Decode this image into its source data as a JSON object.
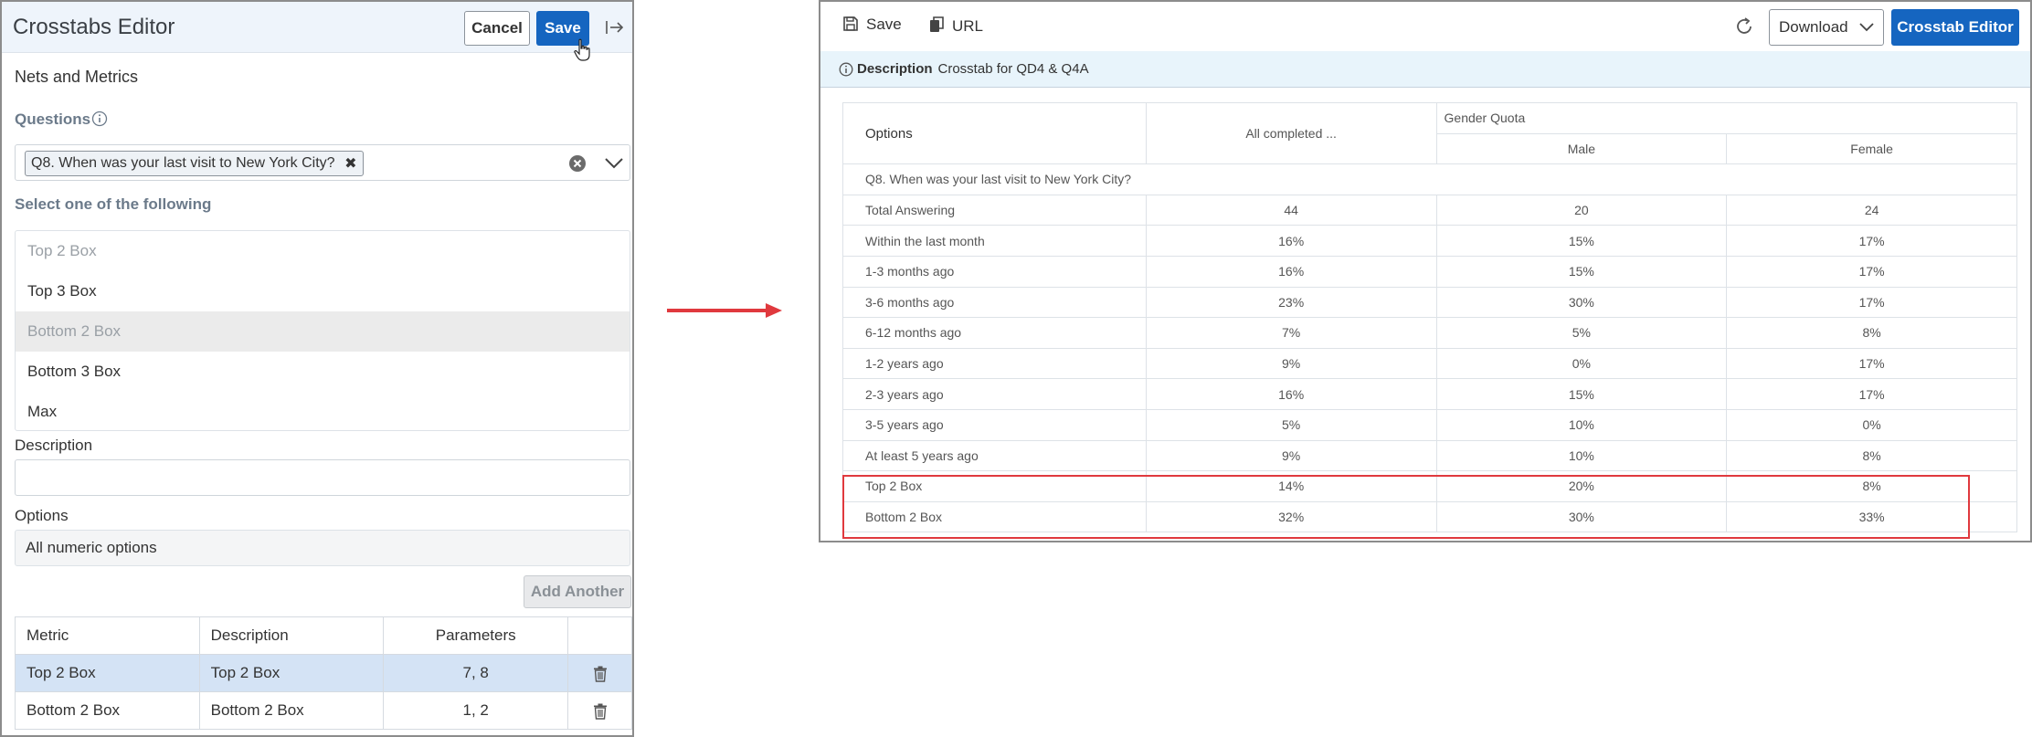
{
  "editor": {
    "title": "Crosstabs Editor",
    "cancel_label": "Cancel",
    "save_label": "Save",
    "section_title": "Nets and Metrics",
    "questions_label": "Questions",
    "selected_question": "Q8. When was your last visit to New York City?",
    "select_label": "Select one of the following",
    "options": [
      {
        "label": "Top 2 Box",
        "state": "disabled"
      },
      {
        "label": "Top 3 Box",
        "state": "normal"
      },
      {
        "label": "Bottom 2 Box",
        "state": "selected-disabled"
      },
      {
        "label": "Bottom 3 Box",
        "state": "normal"
      },
      {
        "label": "Max",
        "state": "normal"
      }
    ],
    "description_label": "Description",
    "description_value": "",
    "options_label": "Options",
    "options_value": "All numeric options",
    "add_another_label": "Add Another",
    "metrics_table": {
      "headers": [
        "Metric",
        "Description",
        "Parameters",
        ""
      ],
      "rows": [
        {
          "metric": "Top 2 Box",
          "description": "Top 2 Box",
          "parameters": "7, 8",
          "selected": true
        },
        {
          "metric": "Bottom 2 Box",
          "description": "Bottom 2 Box",
          "parameters": "1, 2",
          "selected": false
        }
      ]
    }
  },
  "viewer": {
    "toolbar": {
      "save_label": "Save",
      "url_label": "URL",
      "download_label": "Download",
      "crosstab_editor_label": "Crosstab Editor"
    },
    "description_bold": "Description",
    "description_text": "Crosstab for QD4 & Q4A",
    "table": {
      "header_options": "Options",
      "header_all": "All completed ...",
      "header_group": "Gender Quota",
      "header_male": "Male",
      "header_female": "Female",
      "question_row": "Q8. When was your last visit to New York City?",
      "rows": [
        [
          "Total Answering",
          "44",
          "20",
          "24"
        ],
        [
          "Within the last month",
          "16%",
          "15%",
          "17%"
        ],
        [
          "1-3 months ago",
          "16%",
          "15%",
          "17%"
        ],
        [
          "3-6 months ago",
          "23%",
          "30%",
          "17%"
        ],
        [
          "6-12 months ago",
          "7%",
          "5%",
          "8%"
        ],
        [
          "1-2 years ago",
          "9%",
          "0%",
          "17%"
        ],
        [
          "2-3 years ago",
          "16%",
          "15%",
          "17%"
        ],
        [
          "3-5 years ago",
          "5%",
          "10%",
          "0%"
        ],
        [
          "At least 5 years ago",
          "9%",
          "10%",
          "8%"
        ],
        [
          "Top 2 Box",
          "14%",
          "20%",
          "8%"
        ],
        [
          "Bottom 2 Box",
          "32%",
          "30%",
          "33%"
        ]
      ]
    }
  },
  "colors": {
    "primary_button": "#1565c0",
    "highlight_box": "#e0393e",
    "arrow": "#e0393e"
  }
}
